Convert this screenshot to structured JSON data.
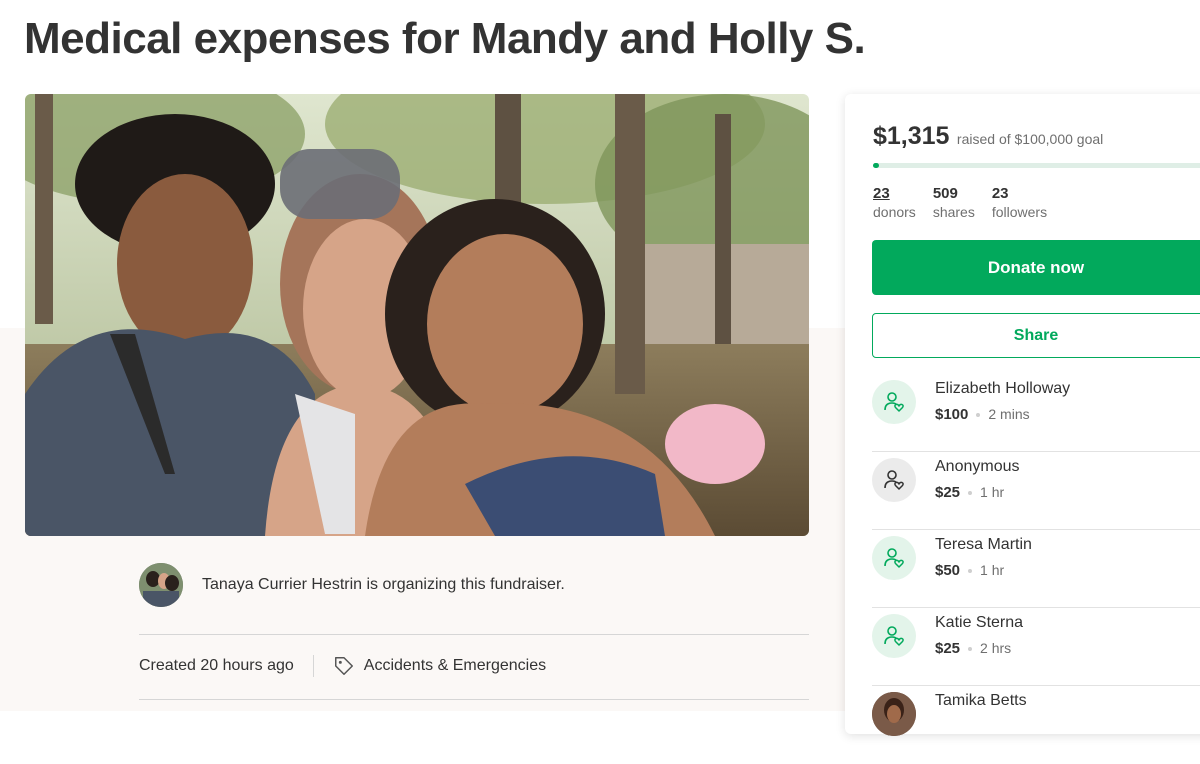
{
  "page": {
    "title": "Medical expenses for Mandy and Holly S."
  },
  "organizer": {
    "text": "Tanaya Currier Hestrin is organizing this fundraiser."
  },
  "meta": {
    "created": "Created 20 hours ago",
    "category": "Accidents & Emergencies"
  },
  "campaign": {
    "raised": "$1,315",
    "goal_text": "raised of $100,000 goal",
    "progress_fraction": 0.013,
    "donors_count": "23",
    "donors_label": "donors",
    "shares_count": "509",
    "shares_label": "shares",
    "followers_count": "23",
    "followers_label": "followers",
    "donate_label": "Donate now",
    "share_label": "Share"
  },
  "donations": [
    {
      "name": "Elizabeth Holloway",
      "amount": "$100",
      "time": "2 mins",
      "icon": "donor-heart-icon"
    },
    {
      "name": "Anonymous",
      "amount": "$25",
      "time": "1 hr",
      "icon": "donor-heart-icon"
    },
    {
      "name": "Teresa Martin",
      "amount": "$50",
      "time": "1 hr",
      "icon": "donor-heart-icon"
    },
    {
      "name": "Katie Sterna",
      "amount": "$25",
      "time": "2 hrs",
      "icon": "donor-heart-icon"
    },
    {
      "name": "Tamika Betts",
      "amount": "",
      "time": "",
      "icon": "avatar-photo"
    }
  ],
  "colors": {
    "brand_green": "#02a95c",
    "light_green": "#e3f4ea",
    "text": "#333333",
    "muted": "#6f6f6f",
    "lower_background": "#fbf8f6"
  }
}
